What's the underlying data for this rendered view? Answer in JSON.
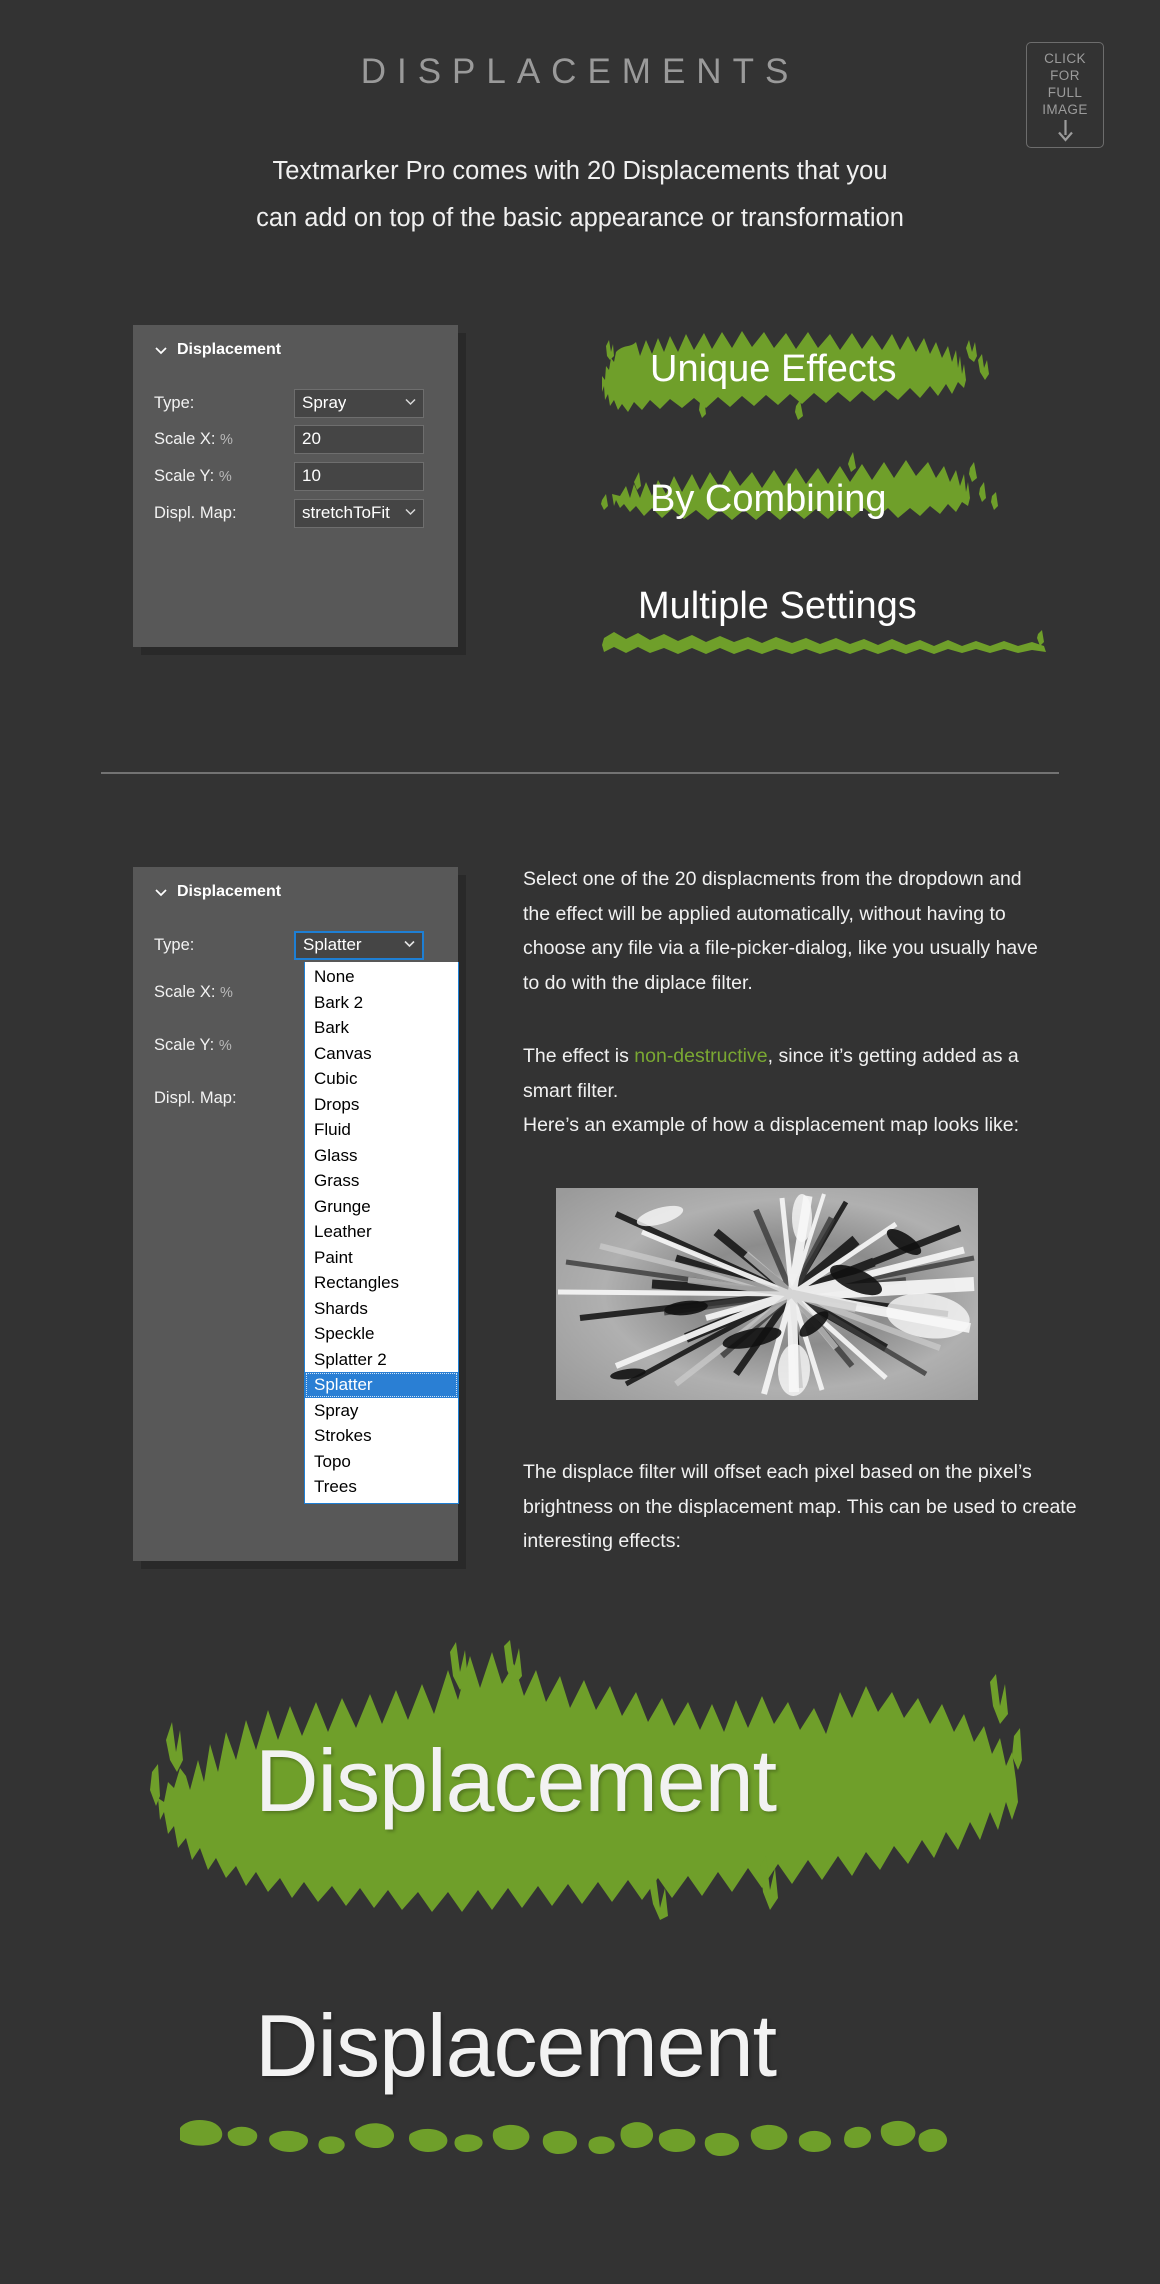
{
  "theme": {
    "page_bg": "#333333",
    "panel_bg": "#585858",
    "field_bg": "#454545",
    "accent_green": "#6f9f2a",
    "accent_green_text": "#7aa832",
    "focus_blue": "#1e7fd4",
    "select_blue": "#2a7fd4",
    "title_gray": "#9a9a9a",
    "body_text": "#f1f1f1",
    "divider": "#737373"
  },
  "header": {
    "title": "DISPLACEMENTS",
    "subtitle_line_1": "Textmarker Pro comes with 20 Displacements that you",
    "subtitle_line_2": "can add on top of the basic appearance or transformation"
  },
  "full_image_badge": {
    "line_1": "CLICK",
    "line_2": "FOR",
    "line_3": "FULL",
    "line_4": "IMAGE",
    "arrow_icon": "arrow-down-icon"
  },
  "panel_top": {
    "header": "Displacement",
    "collapse_icon": "chevron-down-icon",
    "rows": [
      {
        "label": "Type:",
        "unit": "",
        "value": "Spray",
        "kind": "select"
      },
      {
        "label": "Scale X:",
        "unit": "%",
        "value": "20",
        "kind": "text"
      },
      {
        "label": "Scale Y:",
        "unit": "%",
        "value": "10",
        "kind": "text"
      },
      {
        "label": "Displ. Map:",
        "unit": "",
        "value": "stretchToFit",
        "kind": "select"
      }
    ]
  },
  "panel_bottom": {
    "header": "Displacement",
    "collapse_icon": "chevron-down-icon",
    "rows": [
      {
        "label": "Type:",
        "unit": "",
        "value": "Splatter",
        "kind": "select"
      },
      {
        "label": "Scale X:",
        "unit": "%",
        "value": "",
        "kind": "text"
      },
      {
        "label": "Scale Y:",
        "unit": "%",
        "value": "",
        "kind": "text"
      },
      {
        "label": "Displ. Map:",
        "unit": "",
        "value": "",
        "kind": "select"
      }
    ],
    "dropdown": {
      "open": true,
      "selected": "Splatter",
      "options": [
        "None",
        "Bark 2",
        "Bark",
        "Canvas",
        "Cubic",
        "Drops",
        "Fluid",
        "Glass",
        "Grass",
        "Grunge",
        "Leather",
        "Paint",
        "Rectangles",
        "Shards",
        "Speckle",
        "Splatter 2",
        "Splatter",
        "Spray",
        "Strokes",
        "Topo",
        "Trees"
      ]
    }
  },
  "art_labels": {
    "one": "Unique Effects",
    "two": "By Combining",
    "three": "Multiple Settings",
    "big": "Displacement",
    "under": "Displacement"
  },
  "paragraphs": {
    "p1": "Select one of the 20 displacments from the dropdown and the effect will be applied automatically, without having to choose any file via a file-picker-dialog, like you usually have to do with the diplace filter.",
    "p2_before": "The effect is ",
    "p2_accent": "non-destructive",
    "p2_after": ", since it’s getting added as a smart filter.",
    "p2_line2": "Here’s an example of how a displacement map looks like:",
    "p3": "The displace filter will offset each pixel based on the pixel’s brightness on the displacement map. This can be used to create interesting effects:"
  },
  "sample_map": {
    "caption_above": "Here’s an example of how a displacement map looks like:",
    "description": "grayscale radial zoom blur displacement map"
  }
}
